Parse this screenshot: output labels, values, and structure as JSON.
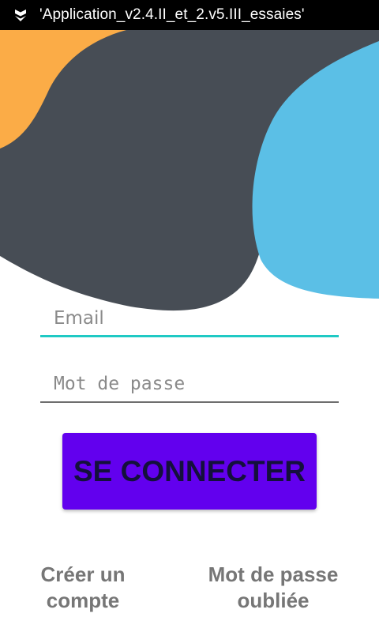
{
  "window": {
    "title": "'Application_v2.4.II_et_2.v5.III_essaies'",
    "icon": "app-shield-icon"
  },
  "header_art": {
    "colors": {
      "orange": "#fbac47",
      "slate": "#474d55",
      "blue": "#5bbfe6"
    }
  },
  "form": {
    "email": {
      "placeholder": "Email",
      "value": ""
    },
    "password": {
      "placeholder": "Mot de passe",
      "value": ""
    },
    "submit_label": "SE CONNECTER"
  },
  "links": {
    "create_account": {
      "line1": "Créer un",
      "line2": "compte"
    },
    "forgot_password": {
      "line1": "Mot de passe",
      "line2": "oubliée"
    }
  },
  "colors": {
    "accent": "#6200ee",
    "focus_underline": "#1fc9c4",
    "title_bar": "#000000"
  }
}
